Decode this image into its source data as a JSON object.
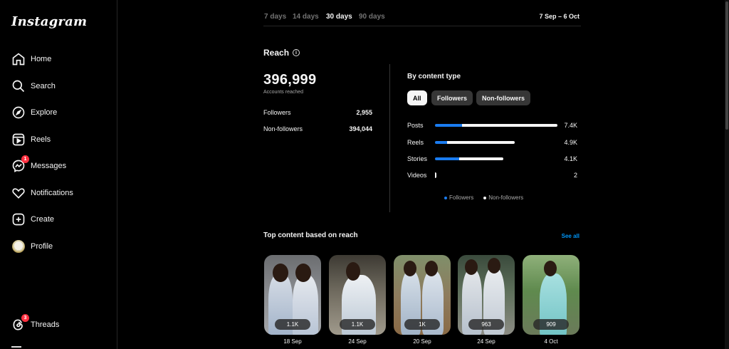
{
  "sidebar": {
    "logo": "Instagram",
    "items": [
      {
        "label": "Home",
        "icon": "home-icon"
      },
      {
        "label": "Search",
        "icon": "search-icon"
      },
      {
        "label": "Explore",
        "icon": "compass-icon"
      },
      {
        "label": "Reels",
        "icon": "reels-icon"
      },
      {
        "label": "Messages",
        "icon": "messenger-icon",
        "badge": "1"
      },
      {
        "label": "Notifications",
        "icon": "heart-icon"
      },
      {
        "label": "Create",
        "icon": "plus-square-icon"
      },
      {
        "label": "Profile",
        "icon": "avatar"
      },
      {
        "label": "Threads",
        "icon": "threads-icon",
        "badge": "3"
      }
    ]
  },
  "range": {
    "tabs": [
      "7 days",
      "14 days",
      "30 days",
      "90 days"
    ],
    "active": "30 days",
    "date_range": "7 Sep – 6 Oct"
  },
  "reach": {
    "title": "Reach",
    "total": "396,999",
    "total_label": "Accounts reached",
    "rows": [
      {
        "label": "Followers",
        "value": "2,955"
      },
      {
        "label": "Non-followers",
        "value": "394,044"
      }
    ]
  },
  "content_type": {
    "title": "By content type",
    "filters": [
      "All",
      "Followers",
      "Non-followers"
    ],
    "active_filter": "All",
    "legend": [
      "Followers",
      "Non-followers"
    ]
  },
  "chart_data": {
    "type": "bar",
    "categories": [
      "Posts",
      "Reels",
      "Stories",
      "Videos"
    ],
    "value_labels": [
      "7.4K",
      "4.9K",
      "4.1K",
      "2"
    ],
    "series": [
      {
        "name": "Followers",
        "values": [
          0.22,
          0.1,
          0.2,
          0
        ]
      },
      {
        "name": "Non-followers",
        "values": [
          0.78,
          0.55,
          0.36,
          0.01
        ]
      }
    ],
    "colors": {
      "Followers": "#1a7cf0",
      "Non-followers": "#f5f5f5"
    }
  },
  "top_content": {
    "title": "Top content based on reach",
    "see_all": "See all",
    "items": [
      {
        "count": "1.1K",
        "date": "18 Sep"
      },
      {
        "count": "1.1K",
        "date": "24 Sep"
      },
      {
        "count": "1K",
        "date": "20 Sep"
      },
      {
        "count": "963",
        "date": "24 Sep"
      },
      {
        "count": "909",
        "date": "4 Oct"
      }
    ]
  }
}
